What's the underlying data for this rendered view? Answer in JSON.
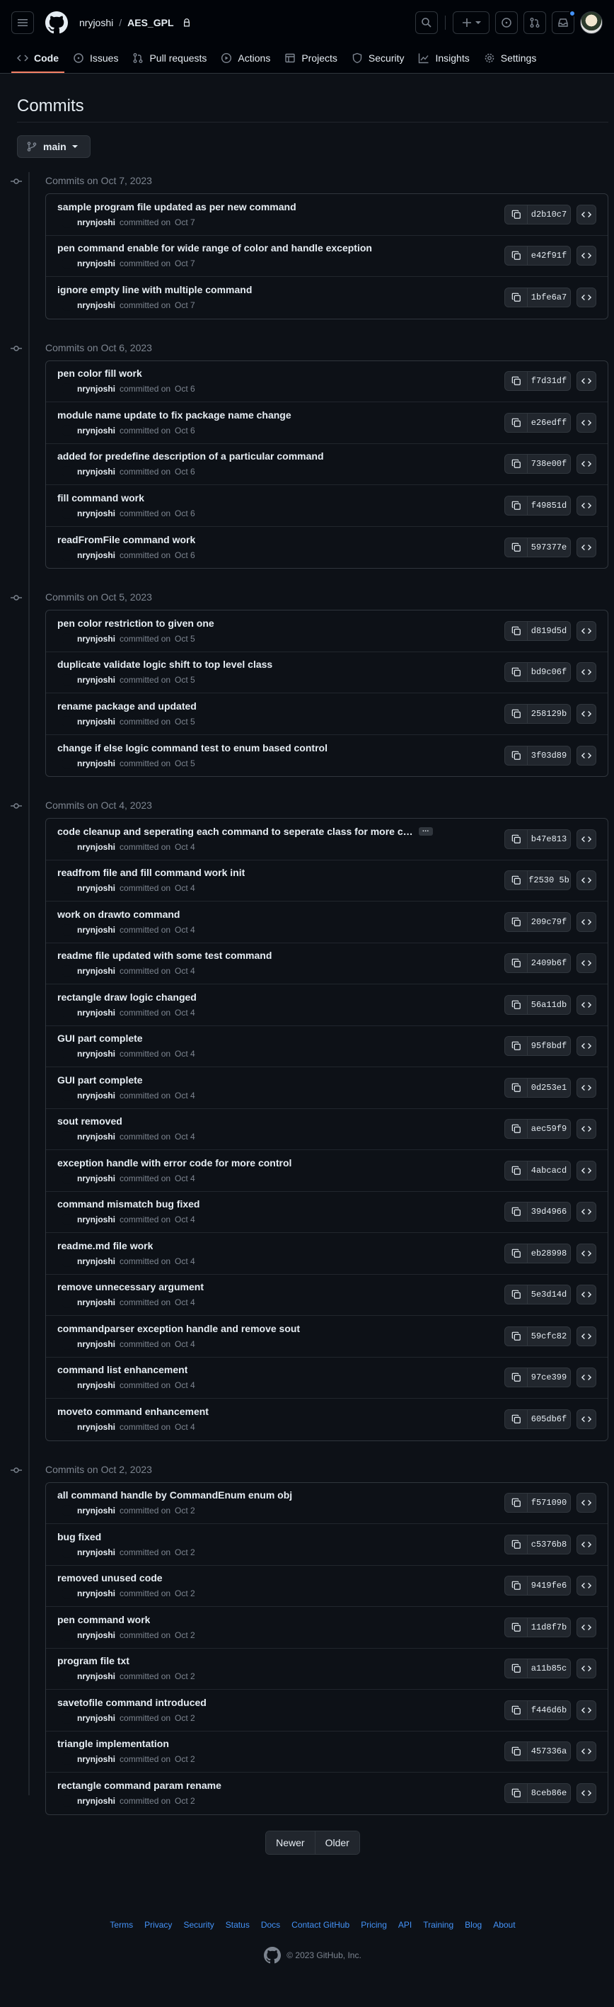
{
  "header": {
    "owner": "nryjoshi",
    "separator": "/",
    "repo": "AES_GPL"
  },
  "nav": {
    "tabs": [
      {
        "label": "Code",
        "icon": "code-icon",
        "active": true
      },
      {
        "label": "Issues",
        "icon": "issue-icon"
      },
      {
        "label": "Pull requests",
        "icon": "pull-request-icon"
      },
      {
        "label": "Actions",
        "icon": "play-icon"
      },
      {
        "label": "Projects",
        "icon": "table-icon"
      },
      {
        "label": "Security",
        "icon": "shield-icon"
      },
      {
        "label": "Insights",
        "icon": "graph-icon"
      },
      {
        "label": "Settings",
        "icon": "gear-icon"
      }
    ]
  },
  "page": {
    "title": "Commits",
    "branch": "main"
  },
  "author": "nrynjoshi",
  "committed_label": "committed on",
  "groups": [
    {
      "heading": "Commits on Oct 7, 2023",
      "commits": [
        {
          "title": "sample program file updated as per new command",
          "date": "Oct 7",
          "sha": "d2b10c7"
        },
        {
          "title": "pen command enable for wide range of color and handle exception",
          "date": "Oct 7",
          "sha": "e42f91f"
        },
        {
          "title": "ignore empty line with multiple command",
          "date": "Oct 7",
          "sha": "1bfe6a7"
        }
      ]
    },
    {
      "heading": "Commits on Oct 6, 2023",
      "commits": [
        {
          "title": "pen color fill work",
          "date": "Oct 6",
          "sha": "f7d31df"
        },
        {
          "title": "module name update to fix package name change",
          "date": "Oct 6",
          "sha": "e26edff"
        },
        {
          "title": "added for predefine description of a particular command",
          "date": "Oct 6",
          "sha": "738e00f"
        },
        {
          "title": "fill command work",
          "date": "Oct 6",
          "sha": "f49851d"
        },
        {
          "title": "readFromFile command work",
          "date": "Oct 6",
          "sha": "597377e"
        }
      ]
    },
    {
      "heading": "Commits on Oct 5, 2023",
      "commits": [
        {
          "title": "pen color restriction to given one",
          "date": "Oct 5",
          "sha": "d819d5d"
        },
        {
          "title": "duplicate validate logic shift to top level class",
          "date": "Oct 5",
          "sha": "bd9c06f"
        },
        {
          "title": "rename package and updated",
          "date": "Oct 5",
          "sha": "258129b"
        },
        {
          "title": "change if else logic command test to enum based control",
          "date": "Oct 5",
          "sha": "3f03d89"
        }
      ]
    },
    {
      "heading": "Commits on Oct 4, 2023",
      "commits": [
        {
          "title": "code cleanup and seperating each command to seperate class for more c…",
          "date": "Oct 4",
          "sha": "b47e813",
          "truncated": true
        },
        {
          "title": "readfrom file and fill command work init",
          "date": "Oct 4",
          "sha": "f2530 5b"
        },
        {
          "title": "work on drawto command",
          "date": "Oct 4",
          "sha": "209c79f"
        },
        {
          "title": "readme file updated with some test command",
          "date": "Oct 4",
          "sha": "2409b6f"
        },
        {
          "title": "rectangle draw logic changed",
          "date": "Oct 4",
          "sha": "56a11db"
        },
        {
          "title": "GUI part complete",
          "date": "Oct 4",
          "sha": "95f8bdf"
        },
        {
          "title": "GUI part complete",
          "date": "Oct 4",
          "sha": "0d253e1"
        },
        {
          "title": "sout removed",
          "date": "Oct 4",
          "sha": "aec59f9"
        },
        {
          "title": "exception handle with error code for more control",
          "date": "Oct 4",
          "sha": "4abcacd"
        },
        {
          "title": "command mismatch bug fixed",
          "date": "Oct 4",
          "sha": "39d4966"
        },
        {
          "title": "readme.md file work",
          "date": "Oct 4",
          "sha": "eb28998"
        },
        {
          "title": "remove unnecessary argument",
          "date": "Oct 4",
          "sha": "5e3d14d"
        },
        {
          "title": "commandparser exception handle and remove sout",
          "date": "Oct 4",
          "sha": "59cfc82"
        },
        {
          "title": "command list enhancement",
          "date": "Oct 4",
          "sha": "97ce399"
        },
        {
          "title": "moveto command enhancement",
          "date": "Oct 4",
          "sha": "605db6f"
        }
      ]
    },
    {
      "heading": "Commits on Oct 2, 2023",
      "commits": [
        {
          "title": "all command handle by CommandEnum enum obj",
          "date": "Oct 2",
          "sha": "f571090"
        },
        {
          "title": "bug fixed",
          "date": "Oct 2",
          "sha": "c5376b8"
        },
        {
          "title": "removed unused code",
          "date": "Oct 2",
          "sha": "9419fe6"
        },
        {
          "title": "pen command work",
          "date": "Oct 2",
          "sha": "11d8f7b"
        },
        {
          "title": "program file txt",
          "date": "Oct 2",
          "sha": "a11b85c"
        },
        {
          "title": "savetofile command introduced",
          "date": "Oct 2",
          "sha": "f446d6b"
        },
        {
          "title": "triangle implementation",
          "date": "Oct 2",
          "sha": "457336a"
        },
        {
          "title": "rectangle command param rename",
          "date": "Oct 2",
          "sha": "8ceb86e"
        }
      ]
    }
  ],
  "pagination": {
    "newer": "Newer",
    "older": "Older"
  },
  "footer": {
    "links": [
      "Terms",
      "Privacy",
      "Security",
      "Status",
      "Docs",
      "Contact GitHub",
      "Pricing",
      "API",
      "Training",
      "Blog",
      "About"
    ],
    "copyright": "© 2023 GitHub, Inc."
  }
}
